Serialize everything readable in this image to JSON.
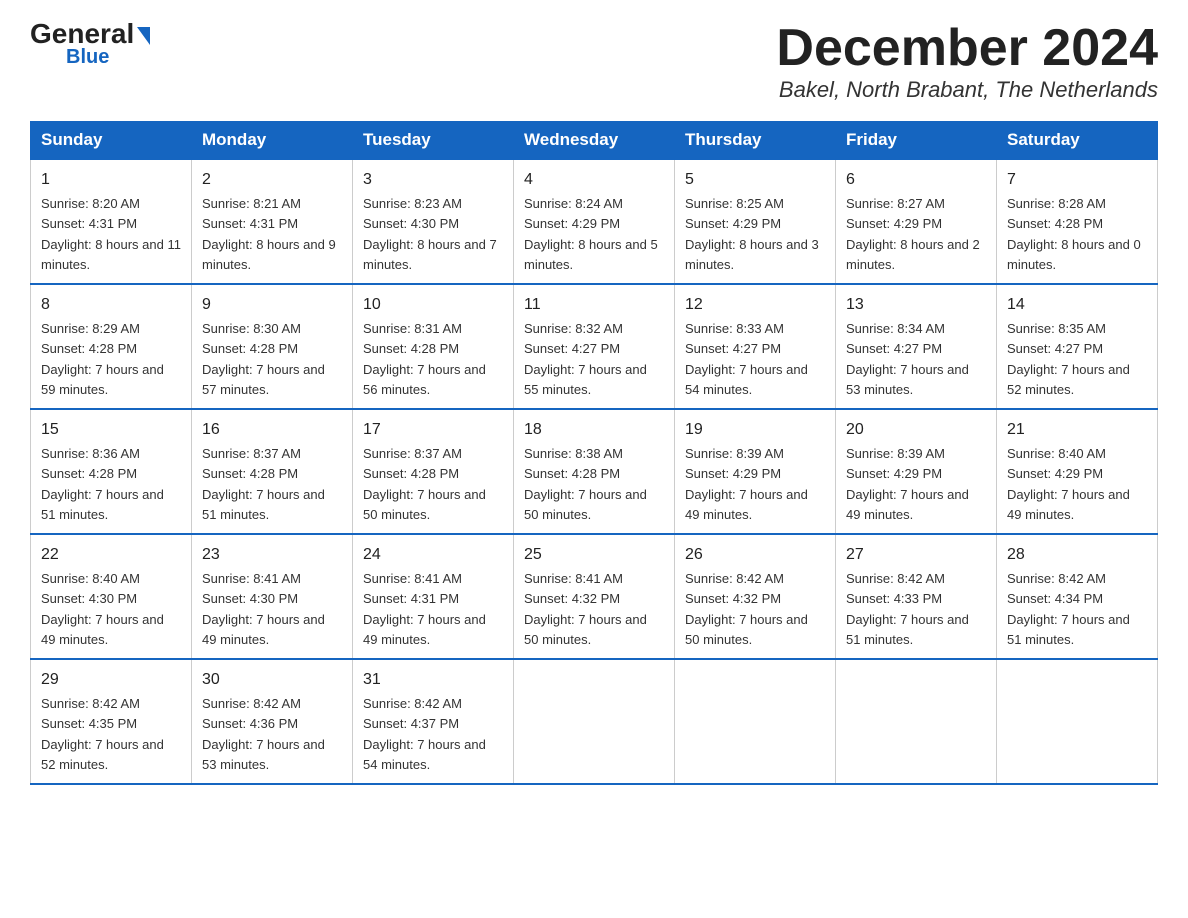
{
  "logo": {
    "general": "General",
    "blue": "Blue",
    "triangle": "▶"
  },
  "title": "December 2024",
  "location": "Bakel, North Brabant, The Netherlands",
  "days_header": [
    "Sunday",
    "Monday",
    "Tuesday",
    "Wednesday",
    "Thursday",
    "Friday",
    "Saturday"
  ],
  "weeks": [
    [
      {
        "num": "1",
        "sunrise": "8:20 AM",
        "sunset": "4:31 PM",
        "daylight": "8 hours and 11 minutes."
      },
      {
        "num": "2",
        "sunrise": "8:21 AM",
        "sunset": "4:31 PM",
        "daylight": "8 hours and 9 minutes."
      },
      {
        "num": "3",
        "sunrise": "8:23 AM",
        "sunset": "4:30 PM",
        "daylight": "8 hours and 7 minutes."
      },
      {
        "num": "4",
        "sunrise": "8:24 AM",
        "sunset": "4:29 PM",
        "daylight": "8 hours and 5 minutes."
      },
      {
        "num": "5",
        "sunrise": "8:25 AM",
        "sunset": "4:29 PM",
        "daylight": "8 hours and 3 minutes."
      },
      {
        "num": "6",
        "sunrise": "8:27 AM",
        "sunset": "4:29 PM",
        "daylight": "8 hours and 2 minutes."
      },
      {
        "num": "7",
        "sunrise": "8:28 AM",
        "sunset": "4:28 PM",
        "daylight": "8 hours and 0 minutes."
      }
    ],
    [
      {
        "num": "8",
        "sunrise": "8:29 AM",
        "sunset": "4:28 PM",
        "daylight": "7 hours and 59 minutes."
      },
      {
        "num": "9",
        "sunrise": "8:30 AM",
        "sunset": "4:28 PM",
        "daylight": "7 hours and 57 minutes."
      },
      {
        "num": "10",
        "sunrise": "8:31 AM",
        "sunset": "4:28 PM",
        "daylight": "7 hours and 56 minutes."
      },
      {
        "num": "11",
        "sunrise": "8:32 AM",
        "sunset": "4:27 PM",
        "daylight": "7 hours and 55 minutes."
      },
      {
        "num": "12",
        "sunrise": "8:33 AM",
        "sunset": "4:27 PM",
        "daylight": "7 hours and 54 minutes."
      },
      {
        "num": "13",
        "sunrise": "8:34 AM",
        "sunset": "4:27 PM",
        "daylight": "7 hours and 53 minutes."
      },
      {
        "num": "14",
        "sunrise": "8:35 AM",
        "sunset": "4:27 PM",
        "daylight": "7 hours and 52 minutes."
      }
    ],
    [
      {
        "num": "15",
        "sunrise": "8:36 AM",
        "sunset": "4:28 PM",
        "daylight": "7 hours and 51 minutes."
      },
      {
        "num": "16",
        "sunrise": "8:37 AM",
        "sunset": "4:28 PM",
        "daylight": "7 hours and 51 minutes."
      },
      {
        "num": "17",
        "sunrise": "8:37 AM",
        "sunset": "4:28 PM",
        "daylight": "7 hours and 50 minutes."
      },
      {
        "num": "18",
        "sunrise": "8:38 AM",
        "sunset": "4:28 PM",
        "daylight": "7 hours and 50 minutes."
      },
      {
        "num": "19",
        "sunrise": "8:39 AM",
        "sunset": "4:29 PM",
        "daylight": "7 hours and 49 minutes."
      },
      {
        "num": "20",
        "sunrise": "8:39 AM",
        "sunset": "4:29 PM",
        "daylight": "7 hours and 49 minutes."
      },
      {
        "num": "21",
        "sunrise": "8:40 AM",
        "sunset": "4:29 PM",
        "daylight": "7 hours and 49 minutes."
      }
    ],
    [
      {
        "num": "22",
        "sunrise": "8:40 AM",
        "sunset": "4:30 PM",
        "daylight": "7 hours and 49 minutes."
      },
      {
        "num": "23",
        "sunrise": "8:41 AM",
        "sunset": "4:30 PM",
        "daylight": "7 hours and 49 minutes."
      },
      {
        "num": "24",
        "sunrise": "8:41 AM",
        "sunset": "4:31 PM",
        "daylight": "7 hours and 49 minutes."
      },
      {
        "num": "25",
        "sunrise": "8:41 AM",
        "sunset": "4:32 PM",
        "daylight": "7 hours and 50 minutes."
      },
      {
        "num": "26",
        "sunrise": "8:42 AM",
        "sunset": "4:32 PM",
        "daylight": "7 hours and 50 minutes."
      },
      {
        "num": "27",
        "sunrise": "8:42 AM",
        "sunset": "4:33 PM",
        "daylight": "7 hours and 51 minutes."
      },
      {
        "num": "28",
        "sunrise": "8:42 AM",
        "sunset": "4:34 PM",
        "daylight": "7 hours and 51 minutes."
      }
    ],
    [
      {
        "num": "29",
        "sunrise": "8:42 AM",
        "sunset": "4:35 PM",
        "daylight": "7 hours and 52 minutes."
      },
      {
        "num": "30",
        "sunrise": "8:42 AM",
        "sunset": "4:36 PM",
        "daylight": "7 hours and 53 minutes."
      },
      {
        "num": "31",
        "sunrise": "8:42 AM",
        "sunset": "4:37 PM",
        "daylight": "7 hours and 54 minutes."
      },
      null,
      null,
      null,
      null
    ]
  ]
}
